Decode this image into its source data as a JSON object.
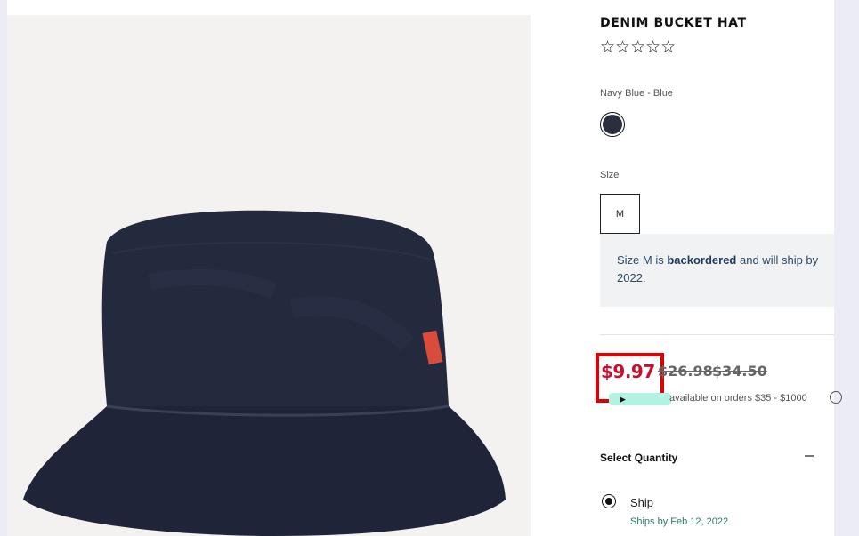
{
  "product": {
    "title": "DENIM BUCKET HAT",
    "rating_stars": "☆☆☆☆☆",
    "color_label": "Navy Blue - Blue",
    "color_swatch_hex": "#2b2e3c",
    "size_label": "Size",
    "selected_size": "M"
  },
  "backorder": {
    "prefix": "Size M is ",
    "emphasis": "backordered",
    "suffix": " and will ship by 2022."
  },
  "pricing": {
    "sale_price": "$9.97",
    "original_price_1": "$26.98",
    "original_price_2": "$34.50",
    "pay_badge": "▶",
    "financing_text": "available on orders $35 - $1000"
  },
  "quantity": {
    "label": "Select Quantity",
    "ship_option": "Ship",
    "ship_date": "Ships by Feb 12, 2022"
  },
  "colors": {
    "sale_red": "#c8102e",
    "highlight_box": "#e00000",
    "ship_green": "#2c7a68"
  },
  "icons": {
    "info": "info-icon",
    "collapse": "minus-icon",
    "radio": "radio-selected-icon"
  }
}
